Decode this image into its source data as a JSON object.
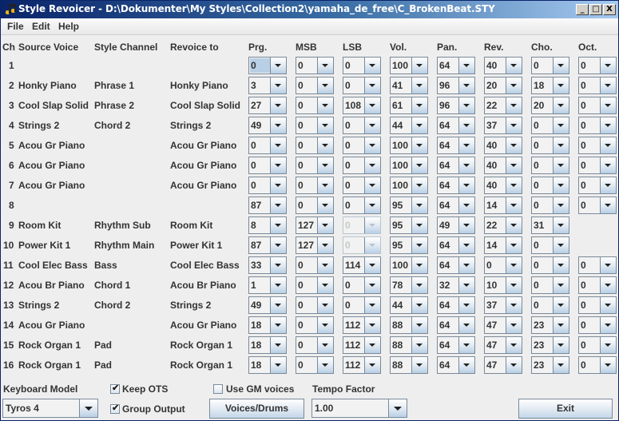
{
  "window": {
    "title": "Style Revoicer - D:\\Dokumenter\\My Styles\\Collection2\\yamaha_de_free\\C_BrokenBeat.STY",
    "icon": "music-note-icon",
    "controls": {
      "minimize": "_",
      "maximize": "□",
      "close": "X"
    }
  },
  "menu": [
    "File",
    "Edit",
    "Help"
  ],
  "headers": {
    "ch": "Ch",
    "source": "Source Voice",
    "style_channel": "Style Channel",
    "revoice": "Revoice to",
    "prg": "Prg.",
    "msb": "MSB",
    "lsb": "LSB",
    "vol": "Vol.",
    "pan": "Pan.",
    "rev": "Rev.",
    "cho": "Cho.",
    "oct": "Oct."
  },
  "rows": [
    {
      "ch": "1",
      "source": "",
      "style_channel": "",
      "revoice": "",
      "prg": "0",
      "msb": "0",
      "lsb": "0",
      "vol": "100",
      "pan": "64",
      "rev": "40",
      "cho": "0",
      "oct": "0",
      "lsb_disabled": false
    },
    {
      "ch": "2",
      "source": "Honky Piano",
      "style_channel": "Phrase 1",
      "revoice": "Honky Piano",
      "prg": "3",
      "msb": "0",
      "lsb": "0",
      "vol": "41",
      "pan": "96",
      "rev": "20",
      "cho": "18",
      "oct": "0",
      "lsb_disabled": false
    },
    {
      "ch": "3",
      "source": "Cool Slap Solid",
      "style_channel": "Phrase 2",
      "revoice": "Cool Slap Solid",
      "prg": "27",
      "msb": "0",
      "lsb": "108",
      "vol": "61",
      "pan": "96",
      "rev": "22",
      "cho": "20",
      "oct": "0",
      "lsb_disabled": false
    },
    {
      "ch": "4",
      "source": "Strings 2",
      "style_channel": "Chord 2",
      "revoice": "Strings 2",
      "prg": "49",
      "msb": "0",
      "lsb": "0",
      "vol": "44",
      "pan": "64",
      "rev": "37",
      "cho": "0",
      "oct": "0",
      "lsb_disabled": false
    },
    {
      "ch": "5",
      "source": "Acou Gr Piano",
      "style_channel": "",
      "revoice": "Acou Gr Piano",
      "prg": "0",
      "msb": "0",
      "lsb": "0",
      "vol": "100",
      "pan": "64",
      "rev": "40",
      "cho": "0",
      "oct": "0",
      "lsb_disabled": false
    },
    {
      "ch": "6",
      "source": "Acou Gr Piano",
      "style_channel": "",
      "revoice": "Acou Gr Piano",
      "prg": "0",
      "msb": "0",
      "lsb": "0",
      "vol": "100",
      "pan": "64",
      "rev": "40",
      "cho": "0",
      "oct": "0",
      "lsb_disabled": false
    },
    {
      "ch": "7",
      "source": "Acou Gr Piano",
      "style_channel": "",
      "revoice": "Acou Gr Piano",
      "prg": "0",
      "msb": "0",
      "lsb": "0",
      "vol": "100",
      "pan": "64",
      "rev": "40",
      "cho": "0",
      "oct": "0",
      "lsb_disabled": false
    },
    {
      "ch": "8",
      "source": "",
      "style_channel": "",
      "revoice": "",
      "prg": "87",
      "msb": "0",
      "lsb": "0",
      "vol": "95",
      "pan": "64",
      "rev": "14",
      "cho": "0",
      "oct": "0",
      "lsb_disabled": false
    },
    {
      "ch": "9",
      "source": "Room Kit",
      "style_channel": "Rhythm Sub",
      "revoice": "Room Kit",
      "prg": "8",
      "msb": "127",
      "lsb": "0",
      "vol": "95",
      "pan": "49",
      "rev": "22",
      "cho": "31",
      "oct": null,
      "lsb_disabled": true
    },
    {
      "ch": "10",
      "source": "Power Kit 1",
      "style_channel": "Rhythm Main",
      "revoice": "Power Kit 1",
      "prg": "87",
      "msb": "127",
      "lsb": "0",
      "vol": "95",
      "pan": "64",
      "rev": "14",
      "cho": "0",
      "oct": null,
      "lsb_disabled": true
    },
    {
      "ch": "11",
      "source": "Cool Elec Bass",
      "style_channel": "Bass",
      "revoice": "Cool Elec Bass",
      "prg": "33",
      "msb": "0",
      "lsb": "114",
      "vol": "100",
      "pan": "64",
      "rev": "0",
      "cho": "0",
      "oct": "0",
      "lsb_disabled": false
    },
    {
      "ch": "12",
      "source": "Acou Br Piano",
      "style_channel": "Chord 1",
      "revoice": "Acou Br Piano",
      "prg": "1",
      "msb": "0",
      "lsb": "0",
      "vol": "78",
      "pan": "32",
      "rev": "10",
      "cho": "0",
      "oct": "0",
      "lsb_disabled": false
    },
    {
      "ch": "13",
      "source": "Strings 2",
      "style_channel": "Chord 2",
      "revoice": "Strings 2",
      "prg": "49",
      "msb": "0",
      "lsb": "0",
      "vol": "44",
      "pan": "64",
      "rev": "37",
      "cho": "0",
      "oct": "0",
      "lsb_disabled": false
    },
    {
      "ch": "14",
      "source": "Acou Gr Piano",
      "style_channel": "",
      "revoice": "Acou Gr Piano",
      "prg": "18",
      "msb": "0",
      "lsb": "112",
      "vol": "88",
      "pan": "64",
      "rev": "47",
      "cho": "23",
      "oct": "0",
      "lsb_disabled": false
    },
    {
      "ch": "15",
      "source": "Rock Organ 1",
      "style_channel": "Pad",
      "revoice": "Rock Organ 1",
      "prg": "18",
      "msb": "0",
      "lsb": "112",
      "vol": "88",
      "pan": "64",
      "rev": "47",
      "cho": "23",
      "oct": "0",
      "lsb_disabled": false
    },
    {
      "ch": "16",
      "source": "Rock Organ 1",
      "style_channel": "Pad",
      "revoice": "Rock Organ 1",
      "prg": "18",
      "msb": "0",
      "lsb": "112",
      "vol": "88",
      "pan": "64",
      "rev": "47",
      "cho": "23",
      "oct": "0",
      "lsb_disabled": false
    }
  ],
  "footer": {
    "keyboard_model_label": "Keyboard Model",
    "keyboard_model_value": "Tyros 4",
    "keep_ots_label": "Keep OTS",
    "keep_ots_checked": true,
    "group_output_label": "Group Output",
    "group_output_checked": true,
    "use_gm_label": "Use GM voices",
    "use_gm_checked": false,
    "voices_drums_label": "Voices/Drums",
    "tempo_factor_label": "Tempo Factor",
    "tempo_factor_value": "1.00",
    "exit_label": "Exit"
  }
}
